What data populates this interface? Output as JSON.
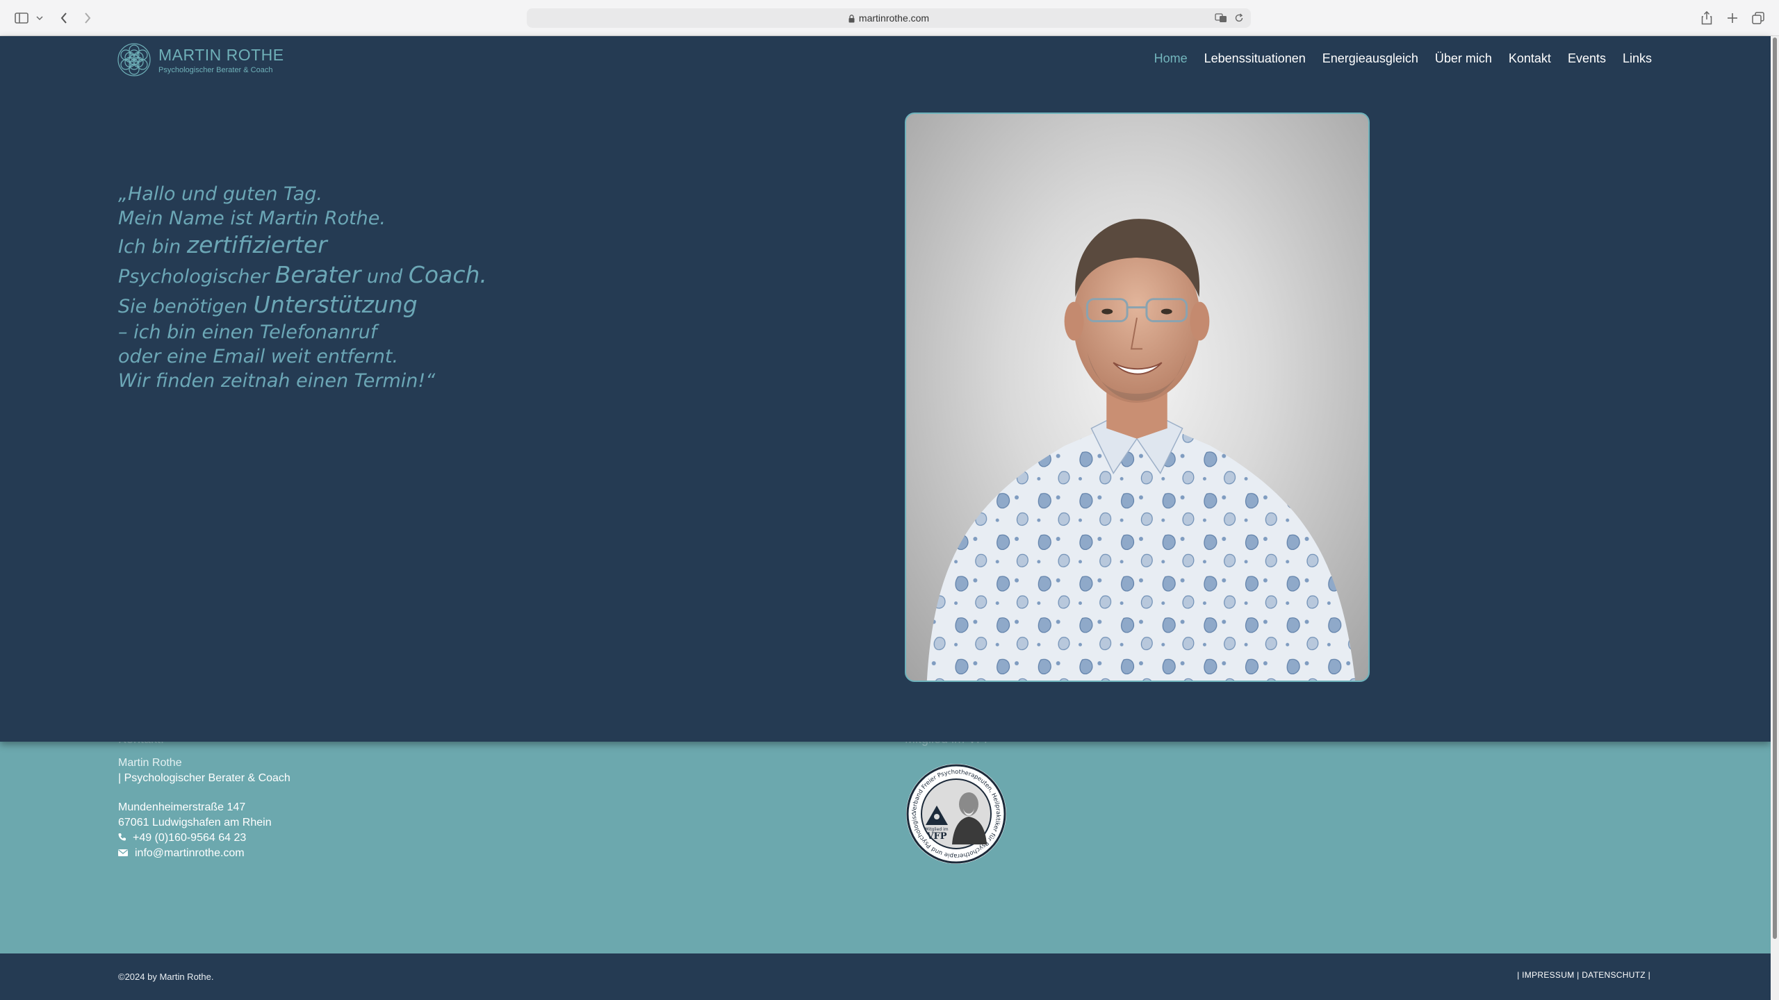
{
  "browser": {
    "url": "martinrothe.com"
  },
  "header": {
    "logo_name": "MARTIN ROTHE",
    "logo_sub": "Psychologischer Berater & Coach",
    "nav": [
      {
        "label": "Home",
        "active": true
      },
      {
        "label": "Lebenssituationen"
      },
      {
        "label": "Energieausgleich"
      },
      {
        "label": "Über mich"
      },
      {
        "label": "Kontakt"
      },
      {
        "label": "Events"
      },
      {
        "label": "Links"
      }
    ]
  },
  "hero": {
    "quote": {
      "l1": "„Hallo und guten Tag.",
      "l2": "Mein Name ist Martin Rothe.",
      "l3a": "Ich bin ",
      "l3b": "zertifizierter",
      "l4a": "Psychologischer ",
      "l4b": "Berater",
      "l4c": " und ",
      "l4d": "Coach.",
      "l5a": "Sie benötigen ",
      "l5b": "Unterstützung",
      "l6": "– ich bin einen Telefonanruf",
      "l7": "oder eine Email weit entfernt.",
      "l8": "Wir finden zeitnah einen Termin!“"
    }
  },
  "contact": {
    "heading": "Kontakt:",
    "name": "Martin Rothe",
    "role": "| Psychologischer Berater & Coach",
    "street": "Mundenheimerstraße 147",
    "city": "67061 Ludwigshafen am Rhein",
    "phone": "+49 (0)160-9564 64 23",
    "email": "info@martinrothe.com",
    "member_heading": "Mitglied im VFP",
    "seal_text": "Verband Freier Psychotherapeuten, Heilpraktiker für Psychotherapie und Psychologischer Berater e.V.",
    "seal_label1": "Mitglied im",
    "seal_label2": "VFP"
  },
  "footer": {
    "copyright": "©2024 by Martin Rothe.",
    "impressum": "IMPRESSUM",
    "datenschutz": "DATENSCHUTZ"
  },
  "colors": {
    "navy": "#253b53",
    "teal": "#6ca8ae",
    "accent": "#73b6bd"
  }
}
